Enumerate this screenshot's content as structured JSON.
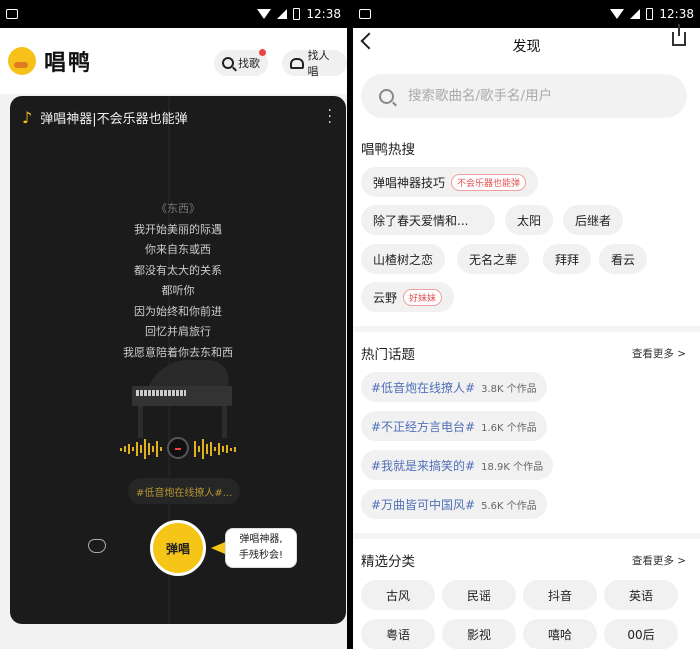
{
  "status_bar": {
    "time": "12:38"
  },
  "left": {
    "logo_text": "唱鸭",
    "search_btn": "找歌",
    "find_people_btn": "找人唱",
    "card_title": "弹唱神器|不会乐器也能弹",
    "song_title": "《东西》",
    "lyrics": [
      "我开始美丽的际遇",
      "你来自东或西",
      "都没有太大的关系",
      "都听你",
      "因为始终和你前进",
      "回忆并肩旅行",
      "我愿意陪着你去东和西"
    ],
    "topic_pill": "#低音炮在线撩人#...",
    "sing_label": "弹唱",
    "tooltip_line1": "弹唱神器,",
    "tooltip_line2": "手残秒会!"
  },
  "right": {
    "title": "发现",
    "search_placeholder": "搜索歌曲名/歌手名/用户",
    "hot_search_title": "唱鸭热搜",
    "hot_search": [
      {
        "label": "弹唱神器技巧",
        "tag": "不会乐器也能弹"
      },
      {
        "label": "除了春天爱情和..."
      },
      {
        "label": "太阳"
      },
      {
        "label": "后继者"
      },
      {
        "label": "山楂树之恋"
      },
      {
        "label": "无名之辈"
      },
      {
        "label": "拜拜"
      },
      {
        "label": "看云"
      },
      {
        "label": "云野",
        "tag": "好妹妹"
      }
    ],
    "hot_topics_title": "热门话题",
    "more_label": "查看更多 >",
    "topics": [
      {
        "name": "#低音炮在线撩人#",
        "count": "3.8K 个作品"
      },
      {
        "name": "#不正经方言电台#",
        "count": "1.6K 个作品"
      },
      {
        "name": "#我就是来搞笑的#",
        "count": "18.9K 个作品"
      },
      {
        "name": "#万曲皆可中国风#",
        "count": "5.6K 个作品"
      }
    ],
    "categories_title": "精选分类",
    "categories": [
      "古风",
      "民谣",
      "抖音",
      "英语",
      "粤语",
      "影视",
      "嘻哈",
      "00后"
    ]
  }
}
